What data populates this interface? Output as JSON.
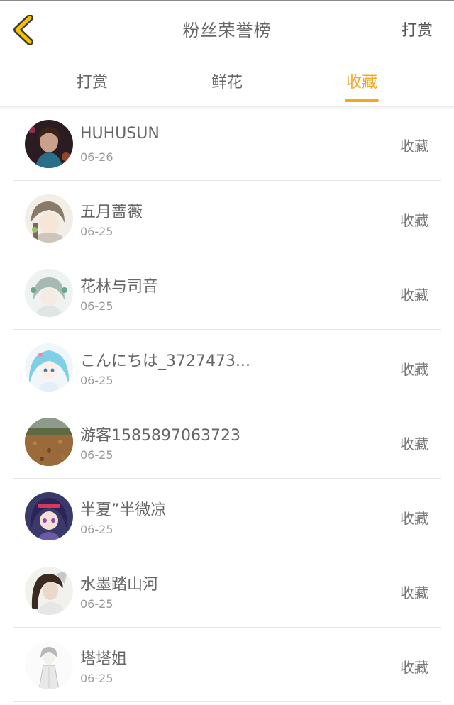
{
  "header": {
    "title": "粉丝荣誉榜",
    "reward_label": "打赏",
    "back_icon": "chevron-left-icon",
    "accent_color": "#f5a623"
  },
  "tabs": [
    {
      "label": "打赏"
    },
    {
      "label": "鲜花"
    },
    {
      "label": "收藏"
    }
  ],
  "active_tab": "收藏",
  "fans": [
    {
      "name": "HUHUSUN",
      "date": "06-26",
      "action": "收藏"
    },
    {
      "name": "五月蔷薇",
      "date": "06-25",
      "action": "收藏"
    },
    {
      "name": "花林与司音",
      "date": "06-25",
      "action": "收藏"
    },
    {
      "name": "こんにちは_3727473...",
      "date": "06-25",
      "action": "收藏"
    },
    {
      "name": "游客1585897063723",
      "date": "06-25",
      "action": "收藏"
    },
    {
      "name": "半夏”半微凉",
      "date": "06-25",
      "action": "收藏"
    },
    {
      "name": "水墨踏山河",
      "date": "06-25",
      "action": "收藏"
    },
    {
      "name": "塔塔姐",
      "date": "06-25",
      "action": "收藏"
    }
  ]
}
